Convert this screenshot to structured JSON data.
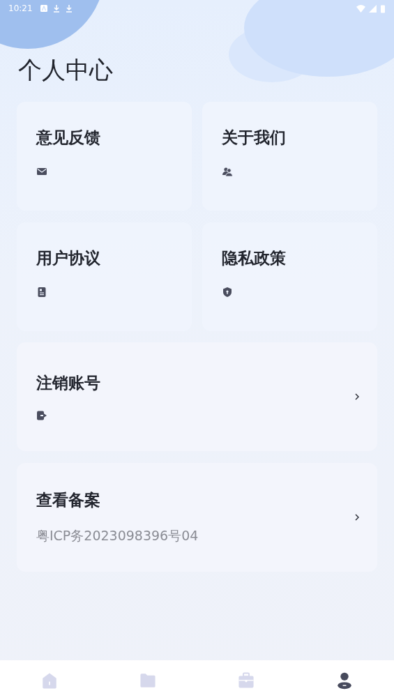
{
  "status_bar": {
    "time": "10:21"
  },
  "title": "个人中心",
  "tiles": [
    {
      "label": "意见反馈"
    },
    {
      "label": "关于我们"
    },
    {
      "label": "用户协议"
    },
    {
      "label": "隐私政策"
    }
  ],
  "rows": [
    {
      "kind": "icon",
      "label": "注销账号"
    },
    {
      "kind": "text",
      "label": "查看备案",
      "subtitle": "粤ICP务2023098396号04"
    }
  ],
  "nav": [
    {
      "selected": false
    },
    {
      "selected": false
    },
    {
      "selected": false
    },
    {
      "selected": true
    }
  ]
}
